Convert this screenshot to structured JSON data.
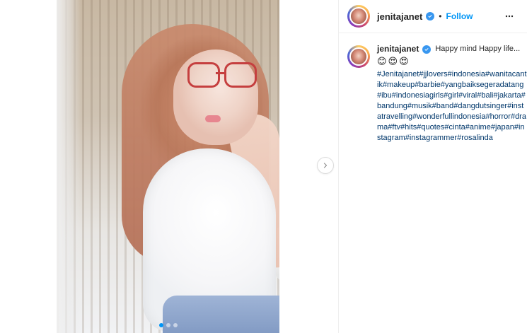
{
  "post": {
    "author": {
      "username": "jenitajanet",
      "verified": true
    },
    "header": {
      "separator": "•",
      "follow_label": "Follow"
    },
    "caption": {
      "text": "Happy mind Happy life...",
      "emojis": "😊😍😍",
      "hashtags": "#Jenitajanet#jjlovers#indonesia#wanitacantik#makeup#barbie#yangbaiksegeradatang#ibu#indonesiagirls#girl#viral#bali#jakarta#bandung#musik#band#dangdutsinger#instatravelling#wonderfullindonesia#horror#drama#ftv#hits#quotes#cinta#anime#japan#instagram#instagrammer#rosalinda"
    },
    "media": {
      "carousel_dots": 3,
      "active_index": 0
    },
    "icons": {
      "next": "chevron-right-icon",
      "more": "more-horizontal-icon",
      "verified": "verified-badge-icon"
    },
    "colors": {
      "link_blue": "#0095f6",
      "hashtag": "#00376b",
      "text": "#262626",
      "border": "#efefef"
    }
  }
}
